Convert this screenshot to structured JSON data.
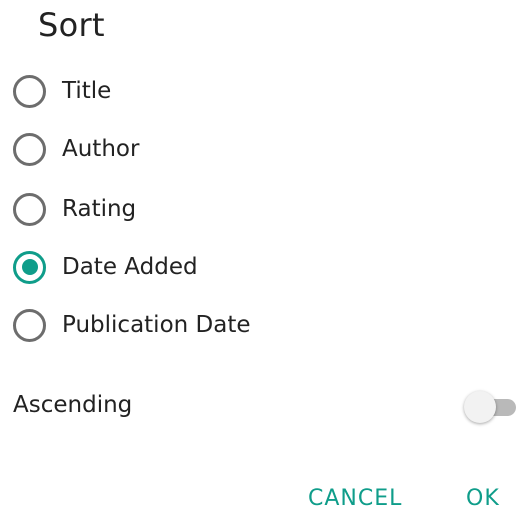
{
  "dialog": {
    "title": "Sort",
    "options": [
      {
        "label": "Title",
        "selected": false
      },
      {
        "label": "Author",
        "selected": false
      },
      {
        "label": "Rating",
        "selected": false
      },
      {
        "label": "Date Added",
        "selected": true
      },
      {
        "label": "Publication Date",
        "selected": false
      }
    ],
    "ascending": {
      "label": "Ascending",
      "enabled": false
    },
    "buttons": {
      "cancel_label": "CANCEL",
      "ok_label": "OK"
    }
  },
  "colors": {
    "accent": "#0f9d8a",
    "radio_unchecked": "#6d6d6d",
    "text": "#222222",
    "switch_track_off": "#b9b9b9",
    "switch_thumb_off": "#f2f2f2"
  }
}
